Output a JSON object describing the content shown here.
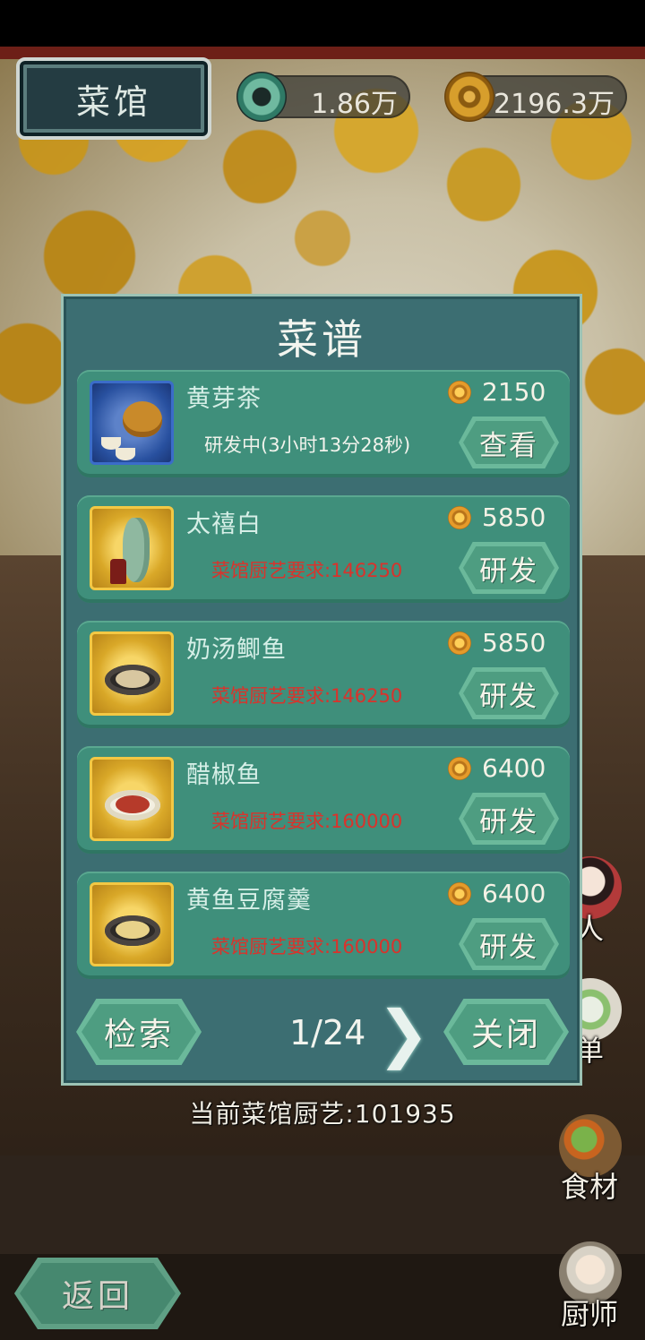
{
  "hud": {
    "title": "菜馆",
    "jade_amount": "1.86万",
    "coin_amount": "2196.3万"
  },
  "dialog": {
    "title": "菜谱",
    "recipes": [
      {
        "name": "黄芽茶",
        "price": "2150",
        "status": "研发中(3小时13分28秒)",
        "button": "查看"
      },
      {
        "name": "太禧白",
        "price": "5850",
        "status": "菜馆厨艺要求:146250",
        "button": "研发"
      },
      {
        "name": "奶汤鲫鱼",
        "price": "5850",
        "status": "菜馆厨艺要求:146250",
        "button": "研发"
      },
      {
        "name": "醋椒鱼",
        "price": "6400",
        "status": "菜馆厨艺要求:160000",
        "button": "研发"
      },
      {
        "name": "黄鱼豆腐羹",
        "price": "6400",
        "status": "菜馆厨艺要求:160000",
        "button": "研发"
      }
    ],
    "search_button": "检索",
    "page": "1/24",
    "close_button": "关闭"
  },
  "craft_line": "当前菜馆厨艺:101935",
  "side_menu": {
    "people": "人",
    "menu": "单",
    "ingredients": "食材",
    "chef": "厨师"
  },
  "back_button": "返回",
  "colors": {
    "panel": "#3c6e72",
    "card": "#3f8f7b",
    "button": "#6bb99b",
    "requirement_text": "#d9332c"
  }
}
